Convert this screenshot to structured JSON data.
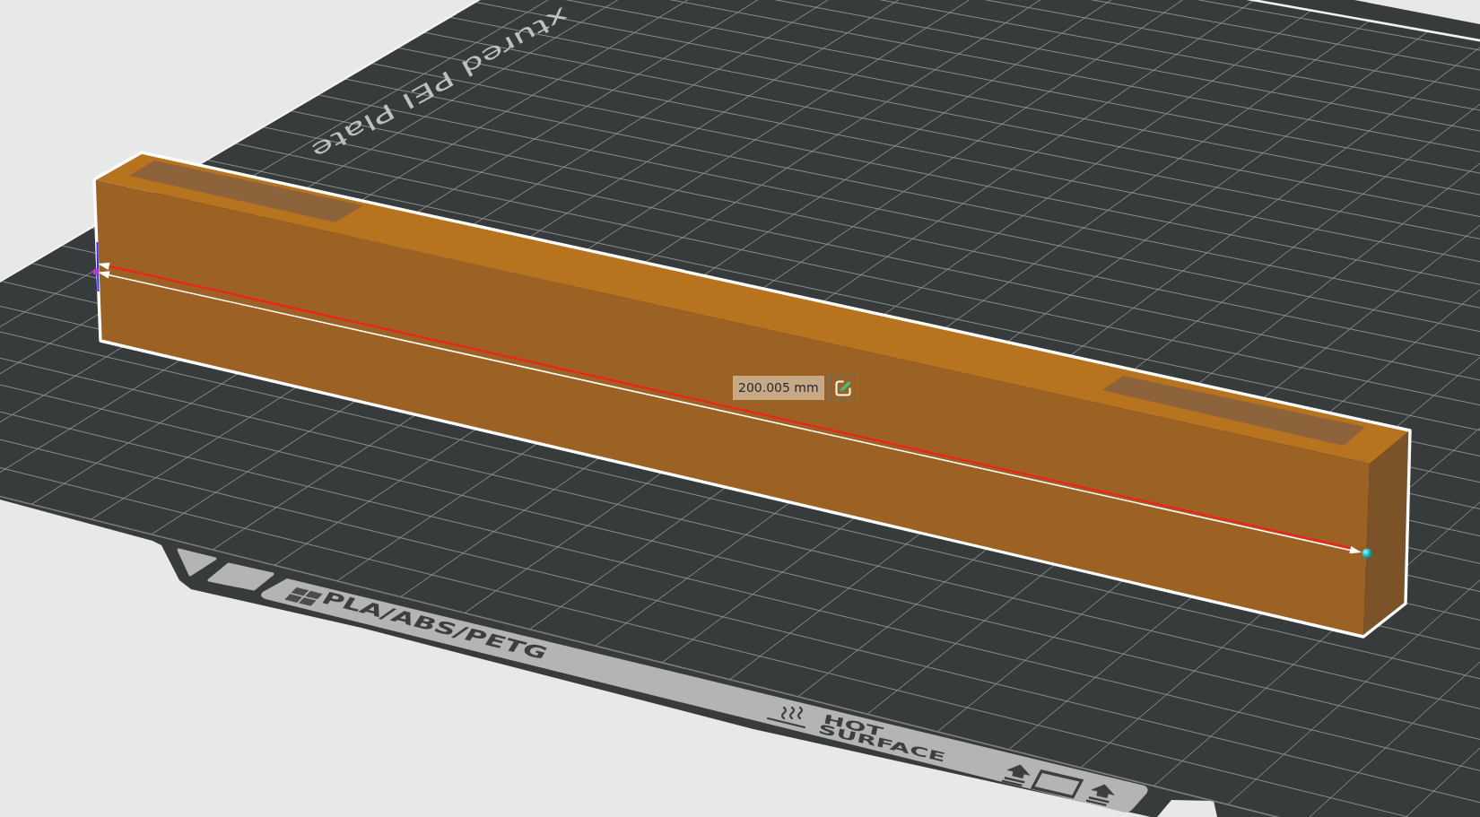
{
  "viewport": {
    "plate_label": "xtured PEI Plate",
    "filament_label": "PLA/ABS/PETG",
    "warning_lines": [
      "HOT",
      "SURFACE"
    ]
  },
  "measurement": {
    "distance": "200.005 mm"
  }
}
